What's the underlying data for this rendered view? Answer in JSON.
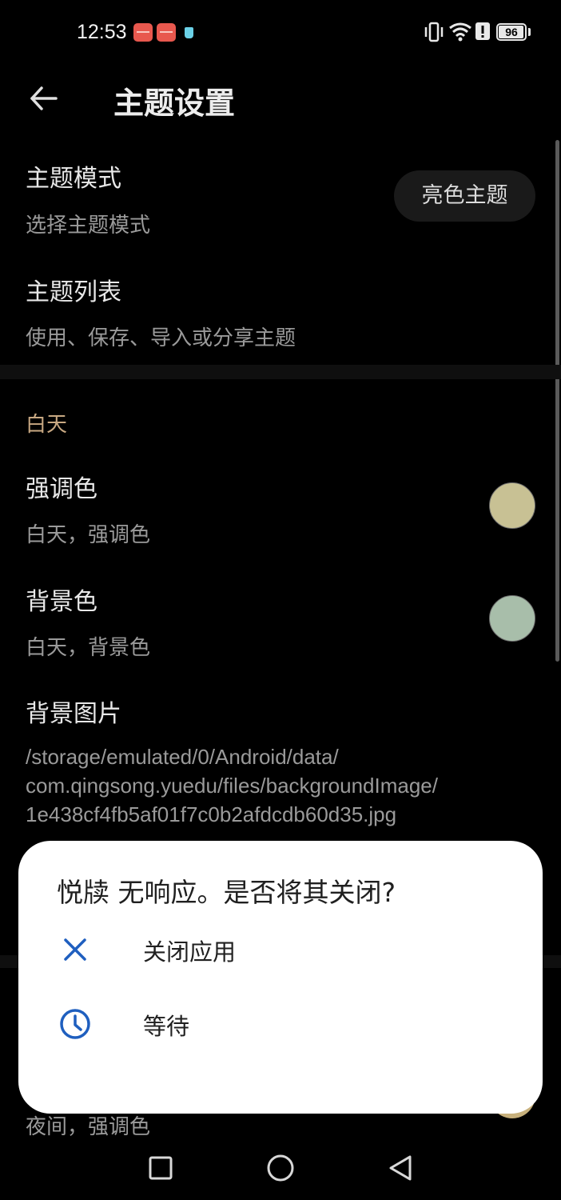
{
  "status_bar": {
    "time": "12:53",
    "battery_level": "96",
    "battery_fraction": 0.96
  },
  "header": {
    "title": "主题设置",
    "back_icon": "arrow-left-icon"
  },
  "preferences": {
    "theme_mode": {
      "title": "主题模式",
      "summary": "选择主题模式",
      "value": "亮色主题"
    },
    "theme_list": {
      "title": "主题列表",
      "summary": "使用、保存、导入或分享主题"
    },
    "day_category": "白天",
    "accent_color": {
      "title": "强调色",
      "summary": "白天，强调色",
      "color": "#c8c194"
    },
    "background_color": {
      "title": "背景色",
      "summary": "白天，背景色",
      "color": "#a8beaa"
    },
    "background_image": {
      "title": "背景图片",
      "path_line_1": "/storage/emulated/0/Android/data/",
      "path_line_2": "com.qingsong.yuedu/files/backgroundImage/",
      "path_line_3": "1e438cf4fb5af01f7c0b2afdcdb60d35.jpg"
    },
    "night_accent_summary": "夜间，强调色"
  },
  "dialog": {
    "title": "悦牍 无响应。是否将其关闭?",
    "actions": [
      {
        "label": "关闭应用",
        "icon": "close-icon"
      },
      {
        "label": "等待",
        "icon": "clock-icon"
      }
    ],
    "accent_color": "#1f5fbf"
  },
  "nav_bar": {
    "recent_icon": "square-icon",
    "home_icon": "circle-icon",
    "back_icon": "triangle-back-icon"
  }
}
